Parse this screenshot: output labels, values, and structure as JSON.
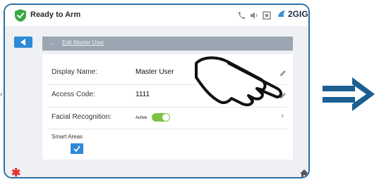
{
  "status_bar": {
    "status_text": "Ready to Arm",
    "brand": "2GIG",
    "colors": {
      "shield": "#3aa845",
      "brand": "#1f2a44"
    },
    "icons": [
      "shield-check-icon",
      "phone-icon",
      "volume-icon",
      "grid-icon",
      "brand-logo-icon"
    ]
  },
  "header": {
    "title": "Edit Master User",
    "back_icon": "back-arrow-icon"
  },
  "form": {
    "display_name": {
      "label": "Display Name:",
      "value": "Master User"
    },
    "access_code": {
      "label": "Access Code:",
      "value": "1111"
    },
    "facial_recognition": {
      "label": "Facial Recognition:",
      "status": "Active",
      "enabled": true
    },
    "smart_areas": {
      "label": "Smart Areas",
      "checked": true
    }
  },
  "footer": {
    "left_icon": "asterisk-icon",
    "right_icon": "home-icon"
  },
  "accent_colors": {
    "primary": "#2e8ad6",
    "toggle_on": "#7dc243",
    "frame": "#2e6fa3",
    "arrow": "#1b5f93"
  }
}
